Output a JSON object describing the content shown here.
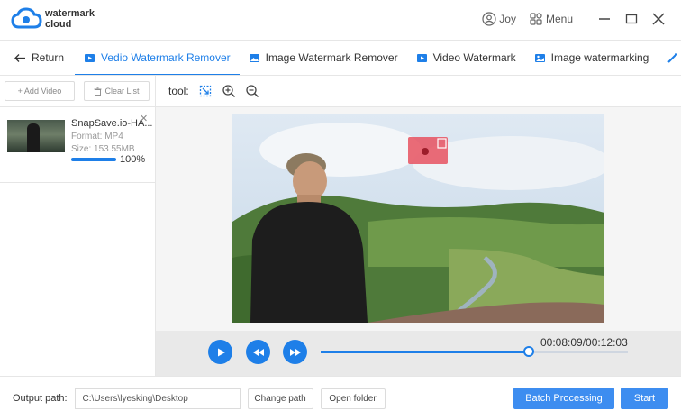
{
  "app": {
    "logo_line1": "watermark",
    "logo_line2": "cloud",
    "user_name": "Joy",
    "menu_label": "Menu",
    "brand_color": "#1e7fe8"
  },
  "tabs": {
    "return_label": "Return",
    "items": [
      {
        "label": "Vedio Watermark Remover",
        "icon": "video-remove-icon",
        "active": true
      },
      {
        "label": "Image Watermark Remover",
        "icon": "image-remove-icon",
        "active": false
      },
      {
        "label": "Video Watermark",
        "icon": "video-watermark-icon",
        "active": false
      },
      {
        "label": "Image watermarking",
        "icon": "image-watermark-icon",
        "active": false
      }
    ]
  },
  "left_panel": {
    "add_video_label": "+ Add Video",
    "clear_list_label": "Clear List",
    "file": {
      "name": "SnapSave.io-HA...",
      "format": "Format:  MP4",
      "size": "Size:  153.55MB",
      "progress_percent": 100,
      "progress_label": "100%"
    }
  },
  "toolbar": {
    "tool_label": "tool:"
  },
  "player": {
    "time": "00:08:09/00:12:03",
    "progress_fraction": 0.676
  },
  "bottom": {
    "output_label": "Output path:",
    "output_path": "C:\\Users\\lyesking\\Desktop",
    "change_path_label": "Change path",
    "open_folder_label": "Open folder",
    "batch_label": "Batch Processing",
    "start_label": "Start"
  }
}
